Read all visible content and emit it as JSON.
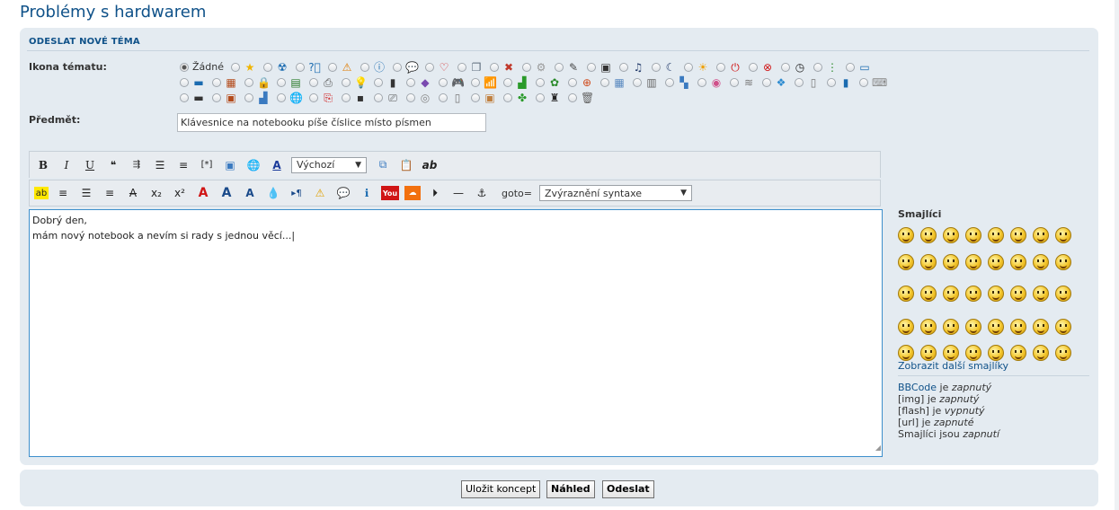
{
  "page": {
    "title": "Problémy s hardwarem"
  },
  "form": {
    "section_title": "ODESLAT NOVÉ TÉMA",
    "icon_label": "Ikona tématu:",
    "icon_none": "Žádné",
    "icon_names": [
      [
        "star-icon",
        "radiation-icon",
        "question-icon",
        "warning-icon",
        "info-icon",
        "speech-bubble-icon",
        "heart-icon",
        "windows-icon",
        "tools-icon",
        "gear-icon",
        "pen-icon",
        "film-icon",
        "music-icon",
        "moon-icon",
        "sun-icon",
        "power-icon",
        "close-icon",
        "clock-icon",
        "traffic-light-icon",
        "monitor-icon"
      ],
      [
        "laptop-icon",
        "calendar-icon",
        "lock-icon",
        "memory-icon",
        "printer-icon",
        "lightbulb-icon",
        "battery-icon",
        "package-icon",
        "gamepad-icon",
        "wifi-icon",
        "signal-icon",
        "bug-icon",
        "lifebuoy-icon",
        "grid-icon",
        "table-icon",
        "chart-icon",
        "palette-icon",
        "database-icon",
        "windows-logo-icon",
        "document-icon",
        "phone-icon",
        "keyboard-icon"
      ],
      [
        "screen-icon",
        "image-icon",
        "bar-chart-icon",
        "globe-icon",
        "pdf-icon",
        "floppy-icon",
        "scanner-icon",
        "cd-icon",
        "usb-icon",
        "box-icon",
        "clover-icon",
        "magician-icon",
        "trash-icon"
      ]
    ],
    "subject_label": "Předmět:",
    "subject_value": "Klávesnice na notebooku píše číslice místo písmen",
    "font_size_select": "Výchozí",
    "goto_label": "goto=",
    "syntax_select": "Zvýraznění syntaxe",
    "message_text": "Dobrý den,\nmám nový notebook a nevím si rady s jednou věcí...|"
  },
  "smileys": {
    "title": "Smajlíci",
    "more_link": "Zobrazit další smajlíky",
    "count_rows": [
      8,
      8,
      8,
      8,
      8
    ]
  },
  "status": {
    "bbcode_link": "BBCode",
    "bbcode_is": " je ",
    "bbcode_state": "zapnutý",
    "img": "[img] je ",
    "img_state": "zapnutý",
    "flash": "[flash] je ",
    "flash_state": "vypnutý",
    "url": "[url] je ",
    "url_state": "zapnuté",
    "smileys": "Smajlíci jsou ",
    "smileys_state": "zapnutí"
  },
  "buttons": {
    "save_draft": "Uložit koncept",
    "preview": "Náhled",
    "submit": "Odeslat"
  },
  "colors": {
    "accent": "#105289",
    "panel": "#e4ebf1",
    "editor_border": "#3d8fcc"
  }
}
